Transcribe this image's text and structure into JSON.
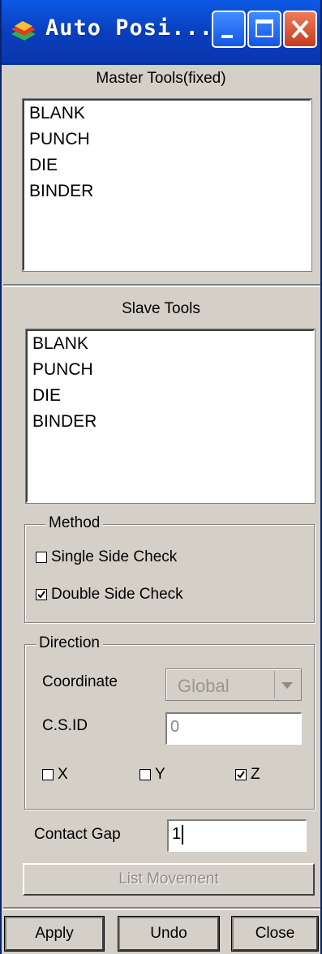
{
  "window": {
    "title": "Auto Posi..."
  },
  "master": {
    "title": "Master Tools(fixed)",
    "items": [
      "BLANK",
      "PUNCH",
      "DIE",
      "BINDER"
    ]
  },
  "slave": {
    "title": "Slave Tools",
    "items": [
      "BLANK",
      "PUNCH",
      "DIE",
      "BINDER"
    ]
  },
  "method": {
    "title": "Method",
    "options": [
      {
        "label": "Single Side Check",
        "checked": false
      },
      {
        "label": "Double Side Check",
        "checked": true
      }
    ]
  },
  "direction": {
    "title": "Direction",
    "coordinate_label": "Coordinate",
    "coordinate_value": "Global",
    "csid_label": "C.S.ID",
    "csid_value": "0",
    "axes": [
      {
        "label": "X",
        "checked": false
      },
      {
        "label": "Y",
        "checked": false
      },
      {
        "label": "Z",
        "checked": true
      }
    ]
  },
  "contact_gap": {
    "label": "Contact Gap",
    "value": "1"
  },
  "buttons": {
    "list_movement": "List Movement",
    "apply": "Apply",
    "undo": "Undo",
    "close": "Close"
  },
  "colors": {
    "titlebar": "#0a3fbf",
    "dialog": "#d4d0c8",
    "close_button": "#c53b1e"
  }
}
